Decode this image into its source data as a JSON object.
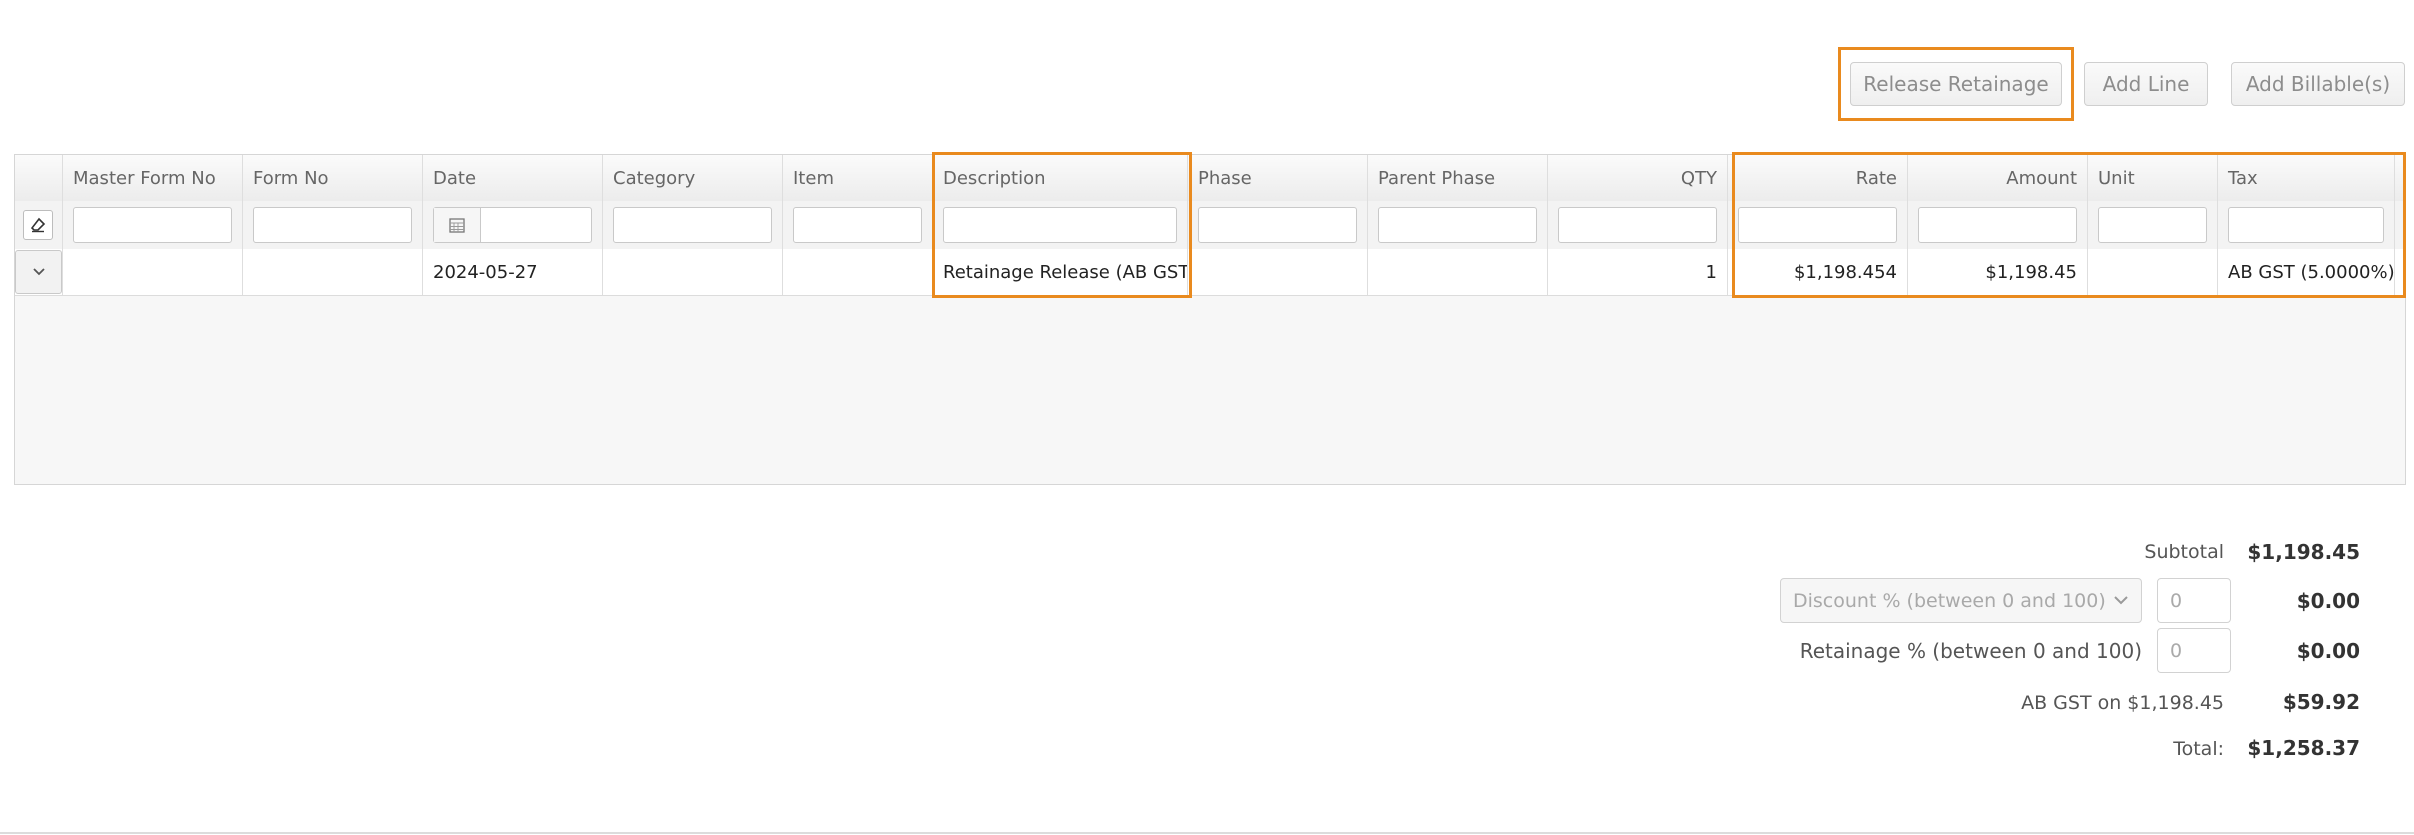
{
  "toolbar": {
    "release_retainage": "Release Retainage",
    "add_line": "Add Line",
    "add_billable": "Add Billable(s)"
  },
  "grid": {
    "columns": [
      "Master Form No",
      "Form No",
      "Date",
      "Category",
      "Item",
      "Description",
      "Phase",
      "Parent Phase",
      "QTY",
      "Rate",
      "Amount",
      "Unit",
      "Tax"
    ],
    "rows": [
      {
        "master_form_no": "",
        "form_no": "",
        "date": "2024-05-27",
        "category": "",
        "item": "",
        "description": "Retainage Release (AB GST)",
        "phase": "",
        "parent_phase": "",
        "qty": "1",
        "rate": "$1,198.454",
        "amount": "$1,198.45",
        "unit": "",
        "tax": "AB GST (5.0000%)"
      }
    ]
  },
  "totals": {
    "subtotal_label": "Subtotal",
    "subtotal_value": "$1,198.45",
    "discount_placeholder": "Discount % (between 0 and 100)",
    "discount_input": "0",
    "discount_value": "$0.00",
    "retainage_label": "Retainage % (between 0 and 100)",
    "retainage_input": "0",
    "retainage_value": "$0.00",
    "tax_label": "AB GST on $1,198.45",
    "tax_value": "$59.92",
    "total_label": "Total:",
    "total_value": "$1,258.37"
  },
  "colors": {
    "highlight": "#e98a1e"
  },
  "icons": {
    "eraser": "eraser-icon",
    "calendar": "calendar-icon",
    "expand": "chevron-down-icon",
    "select": "chevron-down-icon"
  }
}
